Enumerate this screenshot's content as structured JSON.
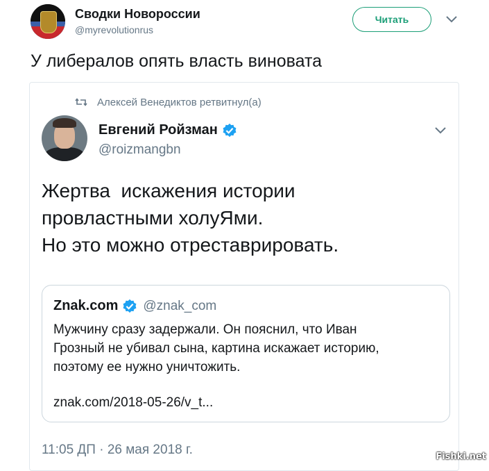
{
  "outer": {
    "account_name": "Сводки Новороссии",
    "handle": "@myrevolutionrus",
    "follow_label": "Читать",
    "tweet_text": "У либералов опять власть виновата"
  },
  "retweet": {
    "retweeted_by": "Алексей Венедиктов ретвитнул(а)",
    "account_name": "Евгений Ройзман",
    "handle": "@roizmangbn",
    "body_lines": [
      "Жертва  искажения истории",
      "провластными холуЯми.",
      "Но это можно отреставрировать."
    ],
    "timestamp": "11:05 ДП · 26 мая 2018 г."
  },
  "quote": {
    "account_name": "Znak.com",
    "handle": "@znak_com",
    "text_lines": [
      "Мужчину сразу задержали. Он пояснил, что Иван",
      "Грозный не убивал сына, картина искажает историю,",
      "поэтому ее нужно уничтожить."
    ],
    "link": "znak.com/2018-05-26/v_t..."
  },
  "watermark": "Fishki.net",
  "colors": {
    "accent_green": "#1b9e77",
    "verified_blue": "#1da1f2",
    "muted_text": "#657786"
  }
}
